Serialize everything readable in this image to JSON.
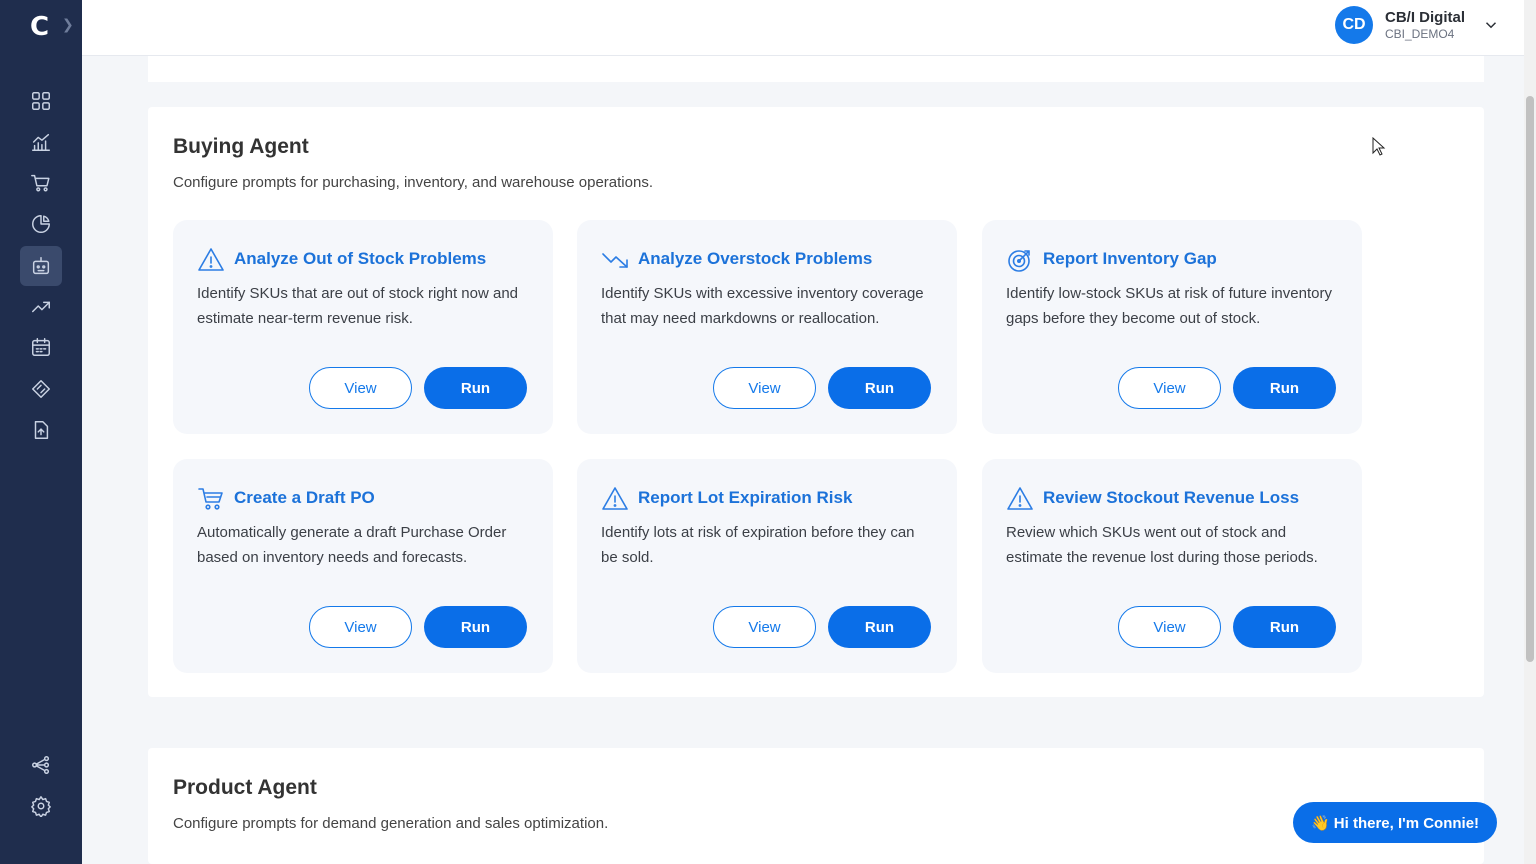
{
  "brand": {
    "logo_letter": "C"
  },
  "sidebar": {
    "items": [
      {
        "icon": "dashboard-grid-icon",
        "active": false
      },
      {
        "icon": "analytics-chart-icon",
        "active": false
      },
      {
        "icon": "shopping-cart-icon",
        "active": false
      },
      {
        "icon": "pie-chart-icon",
        "active": false
      },
      {
        "icon": "robot-agent-icon",
        "active": true
      },
      {
        "icon": "trend-up-icon",
        "active": false
      },
      {
        "icon": "calendar-icon",
        "active": false
      },
      {
        "icon": "diamond-tag-icon",
        "active": false
      },
      {
        "icon": "file-upload-icon",
        "active": false
      },
      {
        "icon": "workflow-share-icon",
        "active": false
      },
      {
        "icon": "gear-icon",
        "active": false
      }
    ]
  },
  "header": {
    "avatar_initials": "CD",
    "org_name": "CB/I Digital",
    "org_id": "CBI_DEMO4"
  },
  "buying_agent": {
    "title": "Buying Agent",
    "description": "Configure prompts for purchasing, inventory, and warehouse operations.",
    "cards": [
      {
        "icon": "warning-triangle-icon",
        "title": "Analyze Out of Stock Problems",
        "description": "Identify SKUs that are out of stock right now and estimate near-term revenue risk.",
        "view_label": "View",
        "run_label": "Run"
      },
      {
        "icon": "trend-down-icon",
        "title": "Analyze Overstock Problems",
        "description": "Identify SKUs with excessive inventory coverage that may need markdowns or reallocation.",
        "view_label": "View",
        "run_label": "Run"
      },
      {
        "icon": "target-icon",
        "title": "Report Inventory Gap",
        "description": "Identify low-stock SKUs at risk of future inventory gaps before they become out of stock.",
        "view_label": "View",
        "run_label": "Run"
      },
      {
        "icon": "shopping-cart-icon",
        "title": "Create a Draft PO",
        "description": "Automatically generate a draft Purchase Order based on inventory needs and forecasts.",
        "view_label": "View",
        "run_label": "Run"
      },
      {
        "icon": "warning-triangle-icon",
        "title": "Report Lot Expiration Risk",
        "description": "Identify lots at risk of expiration before they can be sold.",
        "view_label": "View",
        "run_label": "Run"
      },
      {
        "icon": "warning-triangle-icon",
        "title": "Review Stockout Revenue Loss",
        "description": "Review which SKUs went out of stock and estimate the revenue lost during those periods.",
        "view_label": "View",
        "run_label": "Run"
      }
    ]
  },
  "product_agent": {
    "title": "Product Agent",
    "description": "Configure prompts for demand generation and sales optimization."
  },
  "chat": {
    "label": "👋 Hi there, I'm Connie!"
  },
  "colors": {
    "sidebar_bg": "#1f2d4d",
    "accent": "#0a6ee8",
    "card_title": "#1c72d9",
    "card_bg": "#f5f7fb"
  }
}
